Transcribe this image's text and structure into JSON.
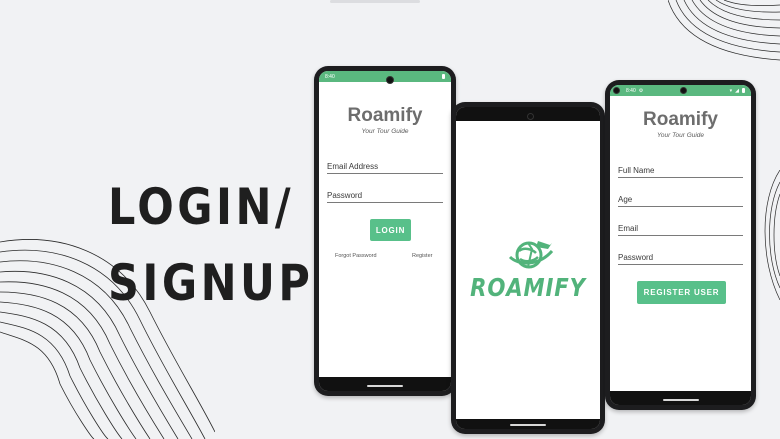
{
  "headline": {
    "line1": "LOGIN/",
    "line2": "SIGNUP"
  },
  "colors": {
    "accent": "#58c08a",
    "status_bar": "#5ab87f",
    "background": "#f1f2f4"
  },
  "login_phone": {
    "status_time": "8:40",
    "app_title": "Roamify",
    "tagline": "Your Tour Guide",
    "email_placeholder": "Email Address",
    "password_placeholder": "Password",
    "login_button": "LOGIN",
    "forgot_link": "Forgot Password",
    "register_link": "Register"
  },
  "splash_phone": {
    "brand": "ROAMIFY",
    "logo_icon": "globe-plane-icon"
  },
  "register_phone": {
    "status_time": "8:40",
    "app_title": "Roamify",
    "tagline": "Your Tour Guide",
    "fullname_placeholder": "Full Name",
    "age_placeholder": "Age",
    "email_placeholder": "Email",
    "password_placeholder": "Password",
    "register_button": "REGISTER USER"
  }
}
